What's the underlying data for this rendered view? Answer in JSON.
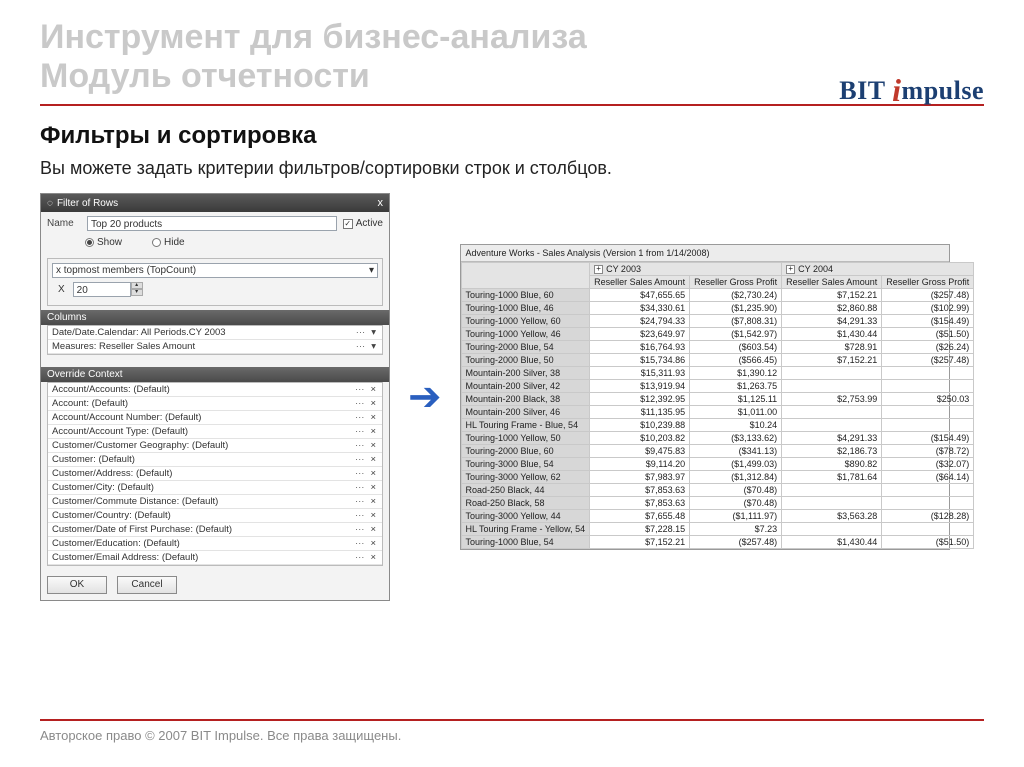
{
  "header": {
    "title_line1": "Инструмент для бизнес-анализа",
    "title_line2": "Модуль отчетности",
    "logo_text_1": "BIT ",
    "logo_text_2": "mpulse"
  },
  "section": {
    "heading": "Фильтры и сортировка",
    "lead": "Вы можете задать критерии фильтров/сортировки строк и столбцов."
  },
  "dialog": {
    "title": "Filter of Rows",
    "close": "x",
    "name_label": "Name",
    "name_value": "Top 20 products",
    "active_label": "Active",
    "active_checked": true,
    "show_label": "Show",
    "hide_label": "Hide",
    "criteria": "x topmost members (TopCount)",
    "x_label": "X",
    "x_value": "20",
    "columns_header": "Columns",
    "columns": [
      "Date/Date.Calendar: All Periods.CY 2003",
      "Measures: Reseller Sales Amount"
    ],
    "override_header": "Override Context",
    "overrides": [
      "Account/Accounts: (Default)",
      "Account: (Default)",
      "Account/Account Number: (Default)",
      "Account/Account Type: (Default)",
      "Customer/Customer Geography: (Default)",
      "Customer: (Default)",
      "Customer/Address: (Default)",
      "Customer/City: (Default)",
      "Customer/Commute Distance: (Default)",
      "Customer/Country: (Default)",
      "Customer/Date of First Purchase: (Default)",
      "Customer/Education: (Default)",
      "Customer/Email Address: (Default)"
    ],
    "ok": "OK",
    "cancel": "Cancel"
  },
  "report": {
    "title": "Adventure Works - Sales Analysis (Version 1 from 1/14/2008)",
    "year1": "CY 2003",
    "year2": "CY 2004",
    "col_a": "Reseller Sales Amount",
    "col_b": "Reseller Gross Profit",
    "rows": [
      {
        "name": "Touring-1000 Blue, 60",
        "v": [
          "$47,655.65",
          "($2,730.24)",
          "$7,152.21",
          "($257.48)"
        ]
      },
      {
        "name": "Touring-1000 Blue, 46",
        "v": [
          "$34,330.61",
          "($1,235.90)",
          "$2,860.88",
          "($102.99)"
        ]
      },
      {
        "name": "Touring-1000 Yellow, 60",
        "v": [
          "$24,794.33",
          "($7,808.31)",
          "$4,291.33",
          "($154.49)"
        ]
      },
      {
        "name": "Touring-1000 Yellow, 46",
        "v": [
          "$23,649.97",
          "($1,542.97)",
          "$1,430.44",
          "($51.50)"
        ]
      },
      {
        "name": "Touring-2000 Blue, 54",
        "v": [
          "$16,764.93",
          "($603.54)",
          "$728.91",
          "($26.24)"
        ]
      },
      {
        "name": "Touring-2000 Blue, 50",
        "v": [
          "$15,734.86",
          "($566.45)",
          "$7,152.21",
          "($257.48)"
        ]
      },
      {
        "name": "Mountain-200 Silver, 38",
        "v": [
          "$15,311.93",
          "$1,390.12",
          "",
          ""
        ]
      },
      {
        "name": "Mountain-200 Silver, 42",
        "v": [
          "$13,919.94",
          "$1,263.75",
          "",
          ""
        ]
      },
      {
        "name": "Mountain-200 Black, 38",
        "v": [
          "$12,392.95",
          "$1,125.11",
          "$2,753.99",
          "$250.03"
        ]
      },
      {
        "name": "Mountain-200 Silver, 46",
        "v": [
          "$11,135.95",
          "$1,011.00",
          "",
          ""
        ]
      },
      {
        "name": "HL Touring Frame - Blue, 54",
        "v": [
          "$10,239.88",
          "$10.24",
          "",
          ""
        ]
      },
      {
        "name": "Touring-1000 Yellow, 50",
        "v": [
          "$10,203.82",
          "($3,133.62)",
          "$4,291.33",
          "($154.49)"
        ]
      },
      {
        "name": "Touring-2000 Blue, 60",
        "v": [
          "$9,475.83",
          "($341.13)",
          "$2,186.73",
          "($78.72)"
        ]
      },
      {
        "name": "Touring-3000 Blue, 54",
        "v": [
          "$9,114.20",
          "($1,499.03)",
          "$890.82",
          "($32.07)"
        ]
      },
      {
        "name": "Touring-3000 Yellow, 62",
        "v": [
          "$7,983.97",
          "($1,312.84)",
          "$1,781.64",
          "($64.14)"
        ]
      },
      {
        "name": "Road-250 Black, 44",
        "v": [
          "$7,853.63",
          "($70.48)",
          "",
          ""
        ]
      },
      {
        "name": "Road-250 Black, 58",
        "v": [
          "$7,853.63",
          "($70.48)",
          "",
          ""
        ]
      },
      {
        "name": "Touring-3000 Yellow, 44",
        "v": [
          "$7,655.48",
          "($1,111.97)",
          "$3,563.28",
          "($128.28)"
        ]
      },
      {
        "name": "HL Touring Frame - Yellow, 54",
        "v": [
          "$7,228.15",
          "$7.23",
          "",
          ""
        ]
      },
      {
        "name": "Touring-1000 Blue, 54",
        "v": [
          "$7,152.21",
          "($257.48)",
          "$1,430.44",
          "($51.50)"
        ]
      }
    ]
  },
  "footer": {
    "copyright": "Авторское право © 2007 BIT Impulse. Все права защищены."
  }
}
